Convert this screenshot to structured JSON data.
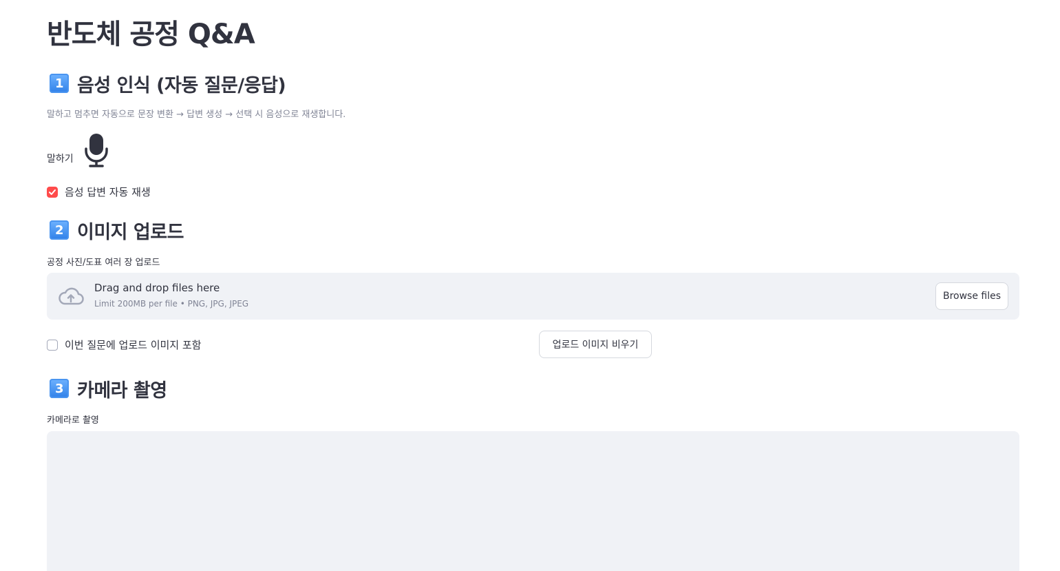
{
  "page": {
    "title": "반도체 공정 Q&A"
  },
  "section1": {
    "keycap": "1",
    "heading": "음성 인식 (자동 질문/응답)",
    "caption": "말하고 멈추면 자동으로 문장 변환 → 답변 생성 → 선택 시 음성으로 재생합니다.",
    "mic_label": "말하기",
    "mic_icon": "microphone-icon",
    "autoplay_label": "음성 답변 자동 재생",
    "autoplay_checked": true
  },
  "section2": {
    "keycap": "2",
    "heading": "이미지 업로드",
    "uploader_label": "공정 사진/도표 여러 장 업로드",
    "drop_text": "Drag and drop files here",
    "limit_text": "Limit 200MB per file • PNG, JPG, JPEG",
    "browse_label": "Browse files",
    "upload_icon": "cloud-upload-icon",
    "include_label": "이번 질문에 업로드 이미지 포함",
    "include_checked": false,
    "clear_label": "업로드 이미지 비우기"
  },
  "section3": {
    "keycap": "3",
    "heading": "카메라 촬영",
    "camera_label": "카메라로 촬영"
  },
  "colors": {
    "accent": "#ff4b4b",
    "text": "#31333f",
    "muted": "#808495",
    "panel": "#f0f2f6"
  }
}
